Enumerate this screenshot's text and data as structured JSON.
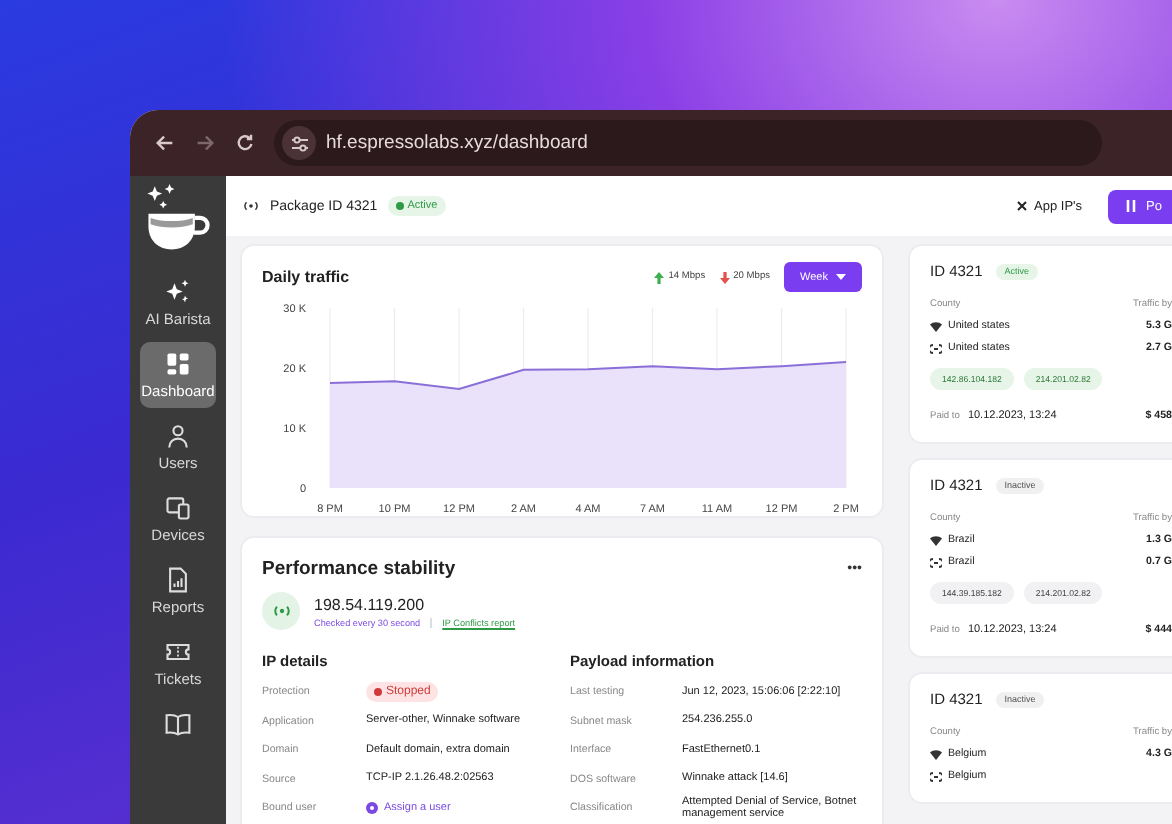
{
  "browser": {
    "url": "hf.espressolabs.xyz/dashboard"
  },
  "sidebar": {
    "items": [
      {
        "kind": "sparkles",
        "label": "AI Barista",
        "selected": false
      },
      {
        "kind": "dashboard",
        "label": "Dashboard",
        "selected": true
      },
      {
        "kind": "user",
        "label": "Users",
        "selected": false
      },
      {
        "kind": "devices",
        "label": "Devices",
        "selected": false
      },
      {
        "kind": "report",
        "label": "Reports",
        "selected": false
      },
      {
        "kind": "ticket",
        "label": "Tickets",
        "selected": false
      },
      {
        "kind": "book",
        "selected": false
      }
    ]
  },
  "header": {
    "package": "Package ID 4321",
    "status": "Active",
    "app_ips": "App IP's",
    "button": "Po"
  },
  "traffic": {
    "title": "Daily traffic",
    "legend": [
      {
        "kind": "up",
        "label": "14 Mbps",
        "color": "#3fae4f"
      },
      {
        "kind": "down",
        "label": "20 Mbps",
        "color": "#e0524a"
      }
    ],
    "period": "Week",
    "chart_data": {
      "type": "area",
      "categories": [
        "8 PM",
        "10 PM",
        "12 PM",
        "2 AM",
        "4 AM",
        "7 AM",
        "11 AM",
        "12 PM",
        "2 PM"
      ],
      "grid": true,
      "series": [
        {
          "color": "#8a6fd8",
          "values": [
            17500,
            17800,
            16500,
            19700,
            19800,
            20300,
            19800,
            20300,
            21000
          ]
        }
      ],
      "ylim": [
        0,
        30000
      ],
      "yticks": [
        {
          "value": 0,
          "label": "0"
        },
        {
          "value": 10000,
          "label": "10 K"
        },
        {
          "value": 20000,
          "label": "20 K"
        },
        {
          "value": 30000,
          "label": "30 K"
        }
      ]
    }
  },
  "performance": {
    "title": "Performance stability",
    "menu": "•••",
    "ip": "198.54.119.200",
    "checked": "Checked every 30 second",
    "report_link": "IP Conflicts report",
    "ip_details": {
      "title": "IP details",
      "rows": [
        {
          "kind": "badge",
          "label": "Protection",
          "value": "Stopped"
        },
        {
          "kind": "text",
          "label": "Application",
          "value": "Server-other, Winnake software"
        },
        {
          "kind": "text",
          "label": "Domain",
          "value": "Default domain, extra domain"
        },
        {
          "kind": "text",
          "label": "Source",
          "value": "TCP-IP 2.1.26.48.2:02563"
        },
        {
          "kind": "link",
          "label": "Bound user",
          "value": "Assign a user"
        }
      ]
    },
    "payload": {
      "title": "Payload information",
      "rows": [
        {
          "label": "Last testing",
          "value": "Jun 12, 2023, 15:06:06 [2:22:10]"
        },
        {
          "label": "Subnet mask",
          "value": "254.236.255.0"
        },
        {
          "label": "Interface",
          "value": "FastEthernet0.1"
        },
        {
          "label": "DOS software",
          "value": "Winnake attack [14.6]"
        },
        {
          "label": "Classification",
          "value": "Attempted Denial of Service, Botnet management service"
        }
      ]
    }
  },
  "packages": [
    {
      "id": "ID 4321",
      "status": "Active",
      "active": true,
      "county_label": "County",
      "traffic_label": "Traffic by",
      "rows": [
        {
          "kind": "wifi",
          "name": "United states",
          "value": "5.3 G"
        },
        {
          "kind": "ethernet",
          "name": "United states",
          "value": "2.7 G"
        }
      ],
      "ips": [
        "142.86.104.182",
        "214.201.02.82"
      ],
      "paid_label": "Paid to",
      "paid_date": "10.12.2023, 13:24",
      "amount": "$ 458"
    },
    {
      "id": "ID 4321",
      "status": "Inactive",
      "active": false,
      "county_label": "County",
      "traffic_label": "Traffic by",
      "rows": [
        {
          "kind": "wifi",
          "name": "Brazil",
          "value": "1.3 G"
        },
        {
          "kind": "ethernet",
          "name": "Brazil",
          "value": "0.7 G"
        }
      ],
      "ips": [
        "144.39.185.182",
        "214.201.02.82"
      ],
      "paid_label": "Paid to",
      "paid_date": "10.12.2023, 13:24",
      "amount": "$ 444"
    },
    {
      "id": "ID 4321",
      "status": "Inactive",
      "active": false,
      "county_label": "County",
      "traffic_label": "Traffic by",
      "rows": [
        {
          "kind": "wifi",
          "name": "Belgium",
          "value": "4.3 G"
        },
        {
          "kind": "ethernet",
          "name": "Belgium"
        }
      ]
    }
  ]
}
